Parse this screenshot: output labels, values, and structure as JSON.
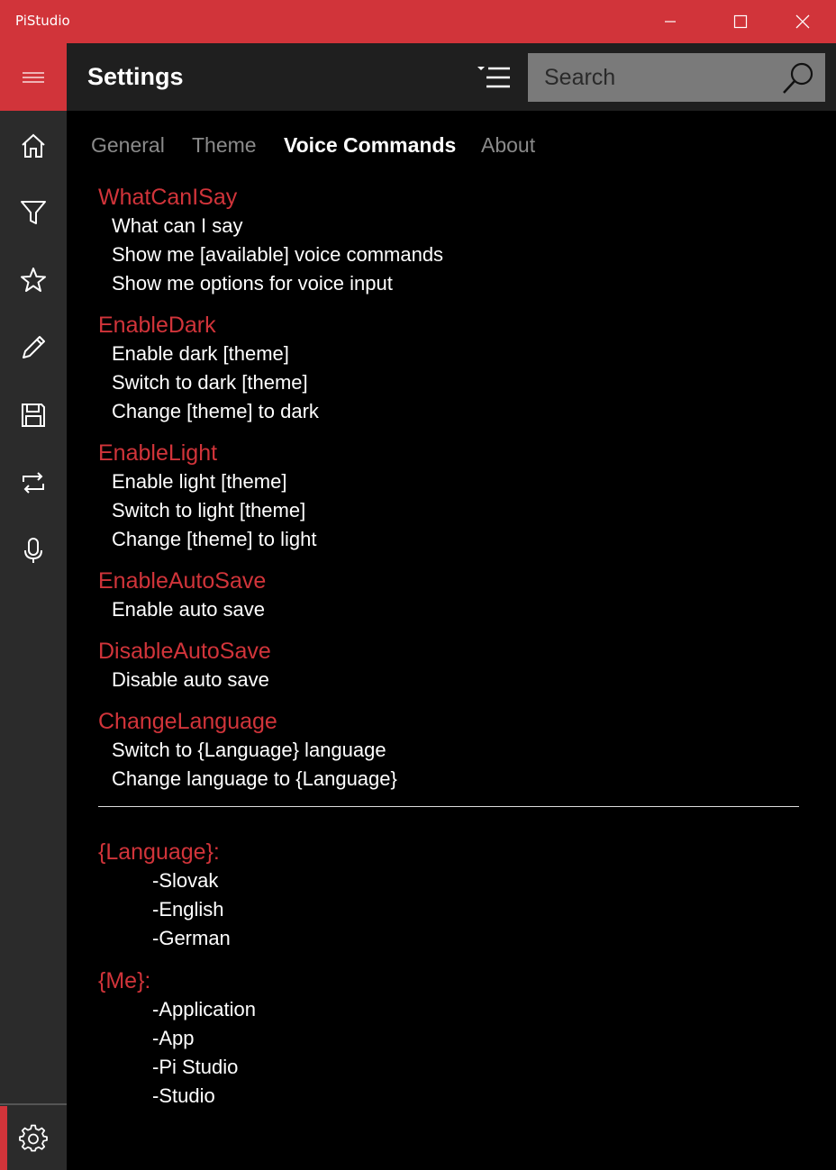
{
  "window": {
    "app_title": "PiStudio",
    "colors": {
      "accent": "#d1343a",
      "nav_bg": "#2b2b2b",
      "header_bg": "#1f1f1f",
      "content_bg": "#000000",
      "search_bg": "#7a7a7a"
    }
  },
  "nav": {
    "items": [
      {
        "name": "home",
        "icon": "home-icon"
      },
      {
        "name": "filter",
        "icon": "filter-icon"
      },
      {
        "name": "favorites",
        "icon": "star-icon"
      },
      {
        "name": "edit",
        "icon": "pencil-icon"
      },
      {
        "name": "save",
        "icon": "save-icon"
      },
      {
        "name": "repeat",
        "icon": "repeat-icon"
      },
      {
        "name": "microphone",
        "icon": "microphone-icon"
      }
    ],
    "settings_icon": "gear-icon"
  },
  "header": {
    "title": "Settings",
    "search_placeholder": "Search"
  },
  "tabs": [
    {
      "label": "General",
      "active": false
    },
    {
      "label": "Theme",
      "active": false
    },
    {
      "label": "Voice Commands",
      "active": true
    },
    {
      "label": "About",
      "active": false
    }
  ],
  "commands": [
    {
      "title": "WhatCanISay",
      "phrases": [
        "What can I say",
        "Show me [available] voice commands",
        "Show me options for voice input"
      ]
    },
    {
      "title": "EnableDark",
      "phrases": [
        "Enable dark [theme]",
        "Switch to dark [theme]",
        "Change [theme] to dark"
      ]
    },
    {
      "title": "EnableLight",
      "phrases": [
        "Enable light [theme]",
        "Switch to light [theme]",
        "Change [theme] to light"
      ]
    },
    {
      "title": "EnableAutoSave",
      "phrases": [
        "Enable auto save"
      ]
    },
    {
      "title": "DisableAutoSave",
      "phrases": [
        "Disable auto save"
      ]
    },
    {
      "title": "ChangeLanguage",
      "phrases": [
        "Switch to {Language} language",
        "Change language to {Language}"
      ]
    }
  ],
  "variables": [
    {
      "title": "{Language}:",
      "items": [
        "-Slovak",
        "-English",
        "-German"
      ]
    },
    {
      "title": "{Me}:",
      "items": [
        "-Application",
        "-App",
        "-Pi Studio",
        "-Studio"
      ]
    }
  ]
}
